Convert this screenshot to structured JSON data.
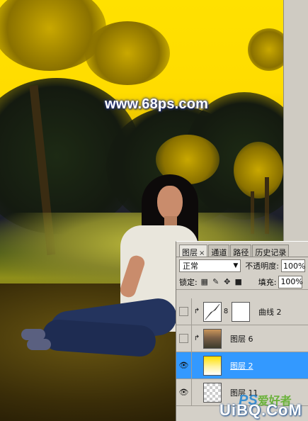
{
  "canvas": {
    "watermark": "www.68ps.com"
  },
  "layers_panel": {
    "tabs": [
      {
        "label": "图层",
        "active": true,
        "closable": true
      },
      {
        "label": "通道",
        "active": false
      },
      {
        "label": "路径",
        "active": false
      },
      {
        "label": "历史记录",
        "active": false
      }
    ],
    "blend_mode": "正常",
    "opacity_label": "不透明度:",
    "opacity_value": "100%",
    "lock_label": "锁定:",
    "fill_label": "填充:",
    "fill_value": "100%",
    "layers": [
      {
        "name": "曲线 2",
        "visible": false,
        "clipped": true,
        "thumb": "curves",
        "has_mask": true,
        "selected": false
      },
      {
        "name": "图层 6",
        "visible": false,
        "clipped": true,
        "thumb": "photo",
        "has_mask": false,
        "selected": false
      },
      {
        "name": "图层 2",
        "visible": true,
        "clipped": false,
        "thumb": "yellow",
        "has_mask": false,
        "selected": true
      },
      {
        "name": "图层 11",
        "visible": true,
        "clipped": false,
        "thumb": "check",
        "has_mask": false,
        "selected": false
      }
    ]
  },
  "brand": {
    "line1_prefix": "PS",
    "line1_suffix": "爱好者",
    "line2": "UiBQ.CoM"
  },
  "colors": {
    "selection": "#3399ff",
    "panel_bg": "#d4d0c8"
  }
}
